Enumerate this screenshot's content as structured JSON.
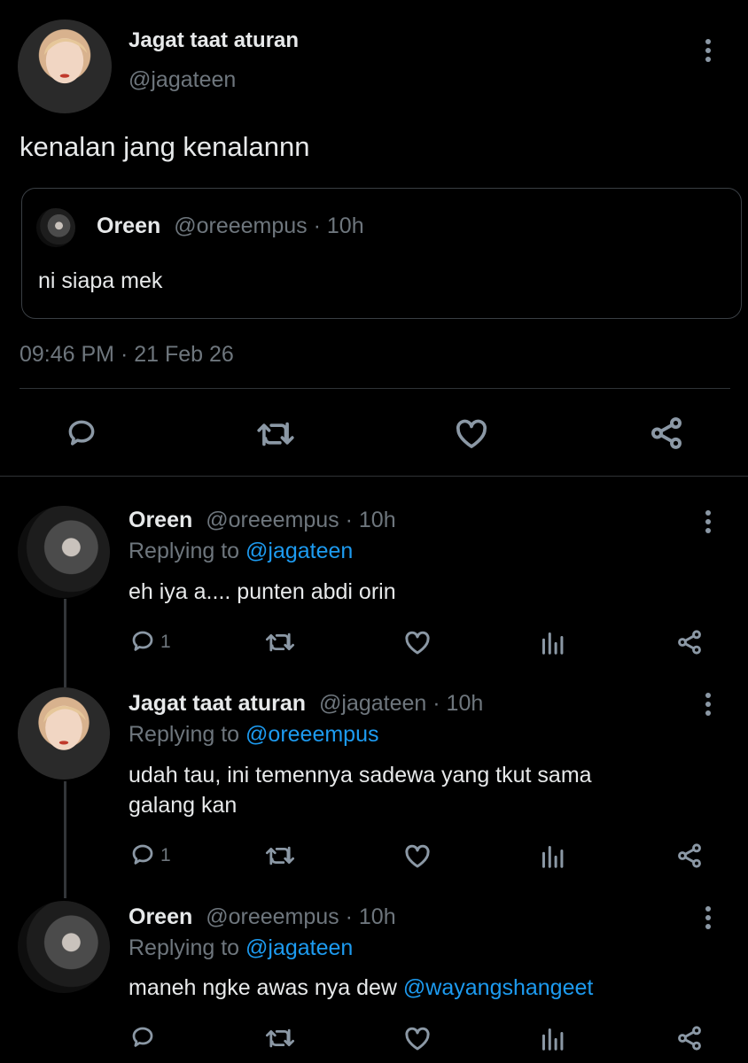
{
  "main_tweet": {
    "display_name": "Jagat taat aturan",
    "handle": "@jagateen",
    "text": "kenalan jang kenalannn",
    "quote": {
      "display_name": "Oreen",
      "handle": "@oreeempus",
      "time": "· 10h",
      "text": "ni siapa mek"
    },
    "timestamp": "09:46 PM · 21 Feb 26"
  },
  "replies": [
    {
      "display_name": "Oreen",
      "handle": "@oreeempus",
      "time": "· 10h",
      "replying_prefix": "Replying to",
      "replying_to": "@jagateen",
      "text_lines": [
        "eh iya a.... punten abdi orin"
      ],
      "reply_count": "1"
    },
    {
      "display_name": "Jagat taat aturan",
      "handle": "@jagateen",
      "time": "· 10h",
      "replying_prefix": "Replying to",
      "replying_to": "@oreeempus",
      "text_lines": [
        "udah tau, ini temennya sadewa yang tkut sama",
        "galang kan"
      ],
      "reply_count": "1"
    },
    {
      "display_name": "Oreen",
      "handle": "@oreeempus",
      "time": "· 10h",
      "replying_prefix": "Replying to",
      "replying_to": "@jagateen",
      "text_plain": "maneh ngke awas nya dew ",
      "text_mention": "@wayangshangeet",
      "reply_count": ""
    }
  ],
  "colors": {
    "background": "#000000",
    "text": "#e7e9ea",
    "muted": "#6e767d",
    "link": "#1d9bf0",
    "divider": "#2f3336"
  }
}
